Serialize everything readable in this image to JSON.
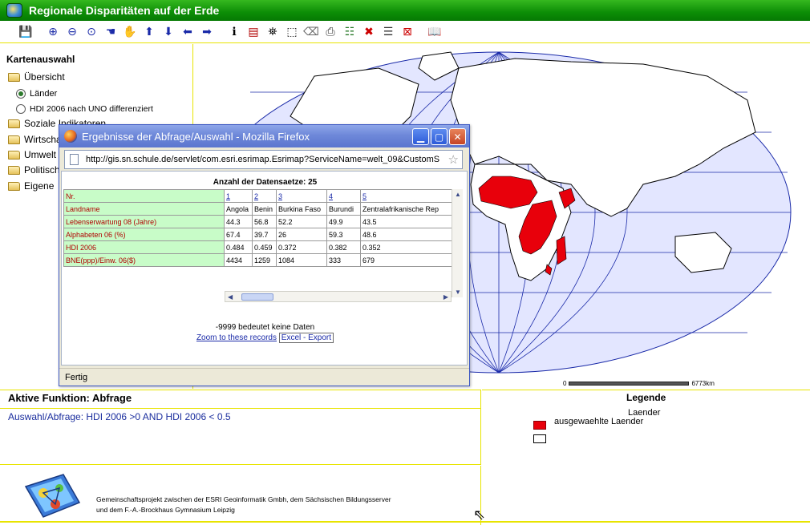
{
  "app": {
    "title": "Regionale Disparitäten auf der Erde"
  },
  "toolbar": {
    "icons": [
      "save-icon",
      "zoom-in-icon",
      "zoom-out-icon",
      "zoom-full-icon",
      "back-icon",
      "pan-icon",
      "up-icon",
      "down-icon",
      "left-icon",
      "right-icon",
      "info-icon",
      "query-icon",
      "find-icon",
      "select-icon",
      "clear-icon",
      "print-icon",
      "legend-icon",
      "delete-icon",
      "list-icon",
      "close-icon",
      "help-icon"
    ]
  },
  "sidebar": {
    "title": "Kartenauswahl",
    "overview": "Übersicht",
    "radio1": "Länder",
    "radio2": "HDI 2006 nach UNO differenziert",
    "folders": [
      "Soziale Indikatoren",
      "Wirtschaft",
      "Umwelt",
      "Politisch",
      "Eigene"
    ]
  },
  "map": {
    "scale_left": "0",
    "scale_right": "6773km",
    "highlight_color": "#e8000b",
    "ocean_color": "#e3e6ff"
  },
  "popup": {
    "title": "Ergebnisse der Abfrage/Auswahl - Mozilla Firefox",
    "url": "http://gis.sn.schule.de/servlet/com.esri.esrimap.Esrimap?ServiceName=welt_09&CustomS",
    "count": "Anzahl der Datensaetze: 25",
    "table": {
      "row_headers": [
        "Nr.",
        "Landname",
        "Lebenserwartung 08 (Jahre)",
        "Alphabeten 06 (%)",
        "HDI 2006",
        "BNE(ppp)/Einw. 06($)"
      ],
      "columns": [
        {
          "nr": "1",
          "land": "Angola",
          "leb": "44.3",
          "alph": "67.4",
          "hdi": "0.484",
          "bne": "4434"
        },
        {
          "nr": "2",
          "land": "Benin",
          "leb": "56.8",
          "alph": "39.7",
          "hdi": "0.459",
          "bne": "1259"
        },
        {
          "nr": "3",
          "land": "Burkina Faso",
          "leb": "52.2",
          "alph": "26",
          "hdi": "0.372",
          "bne": "1084"
        },
        {
          "nr": "4",
          "land": "Burundi",
          "leb": "49.9",
          "alph": "59.3",
          "hdi": "0.382",
          "bne": "333"
        },
        {
          "nr": "5",
          "land": "Zentralafrikanische Rep",
          "leb": "43.5",
          "alph": "48.6",
          "hdi": "0.352",
          "bne": "679"
        }
      ]
    },
    "note": "-9999 bedeutet keine Daten",
    "zoom_link": "Zoom to these records",
    "excel_button": "Excel - Export",
    "status": "Fertig"
  },
  "function_panel": {
    "title": "Aktive Funktion: Abfrage",
    "query": "Auswahl/Abfrage: HDI 2006 >0 AND HDI 2006 < 0.5"
  },
  "legend": {
    "title": "Legende",
    "sub": "Laender",
    "item1": "ausgewaehlte Laender"
  },
  "footer": {
    "line1": "Gemeinschaftsprojekt zwischen der ESRI Geoinformatik Gmbh, dem Sächsischen Bildungsserver",
    "line2": "und dem F.-A.-Brockhaus Gymnasium Leipzig"
  }
}
